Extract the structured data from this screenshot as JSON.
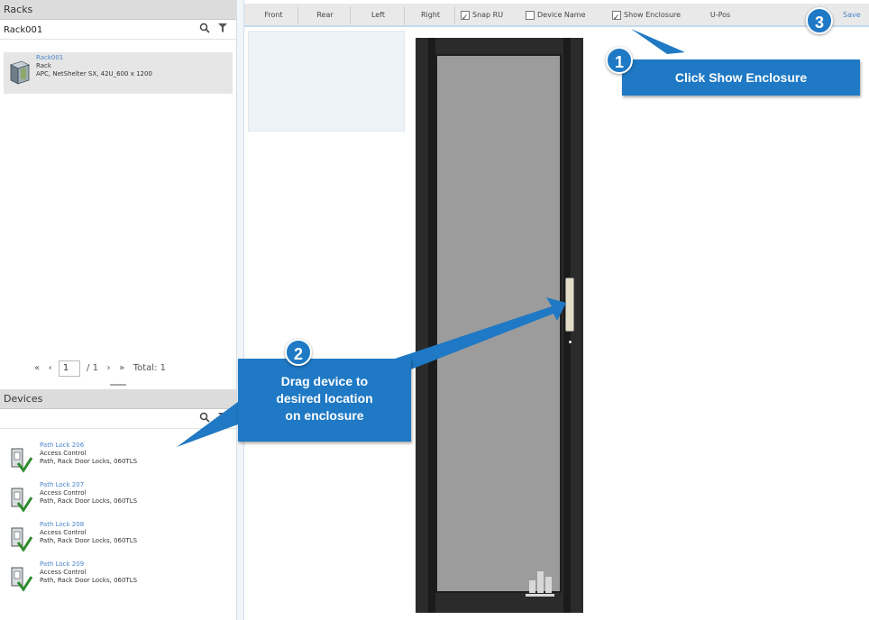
{
  "racks_panel": {
    "title": "Racks",
    "search_value": "Rack001",
    "rack_item": {
      "name": "Rack001",
      "type": "Rack",
      "model": "APC, NetShelter SX, 42U_600 x 1200"
    },
    "pager": {
      "first": "«",
      "prev": "‹",
      "page": "1",
      "of": "/ 1",
      "next": "›",
      "last": "»",
      "total": "Total: 1"
    }
  },
  "devices_panel": {
    "title": "Devices",
    "items": [
      {
        "name": "Path Lock 206",
        "category": "Access Control",
        "model": "Path, Rack Door Locks, 060TLS"
      },
      {
        "name": "Path Lock 207",
        "category": "Access Control",
        "model": "Path, Rack Door Locks, 060TLS"
      },
      {
        "name": "Path Lock 208",
        "category": "Access Control",
        "model": "Path, Rack Door Locks, 060TLS"
      },
      {
        "name": "Path Lock 209",
        "category": "Access Control",
        "model": "Path, Rack Door Locks, 060TLS"
      }
    ]
  },
  "toolbar": {
    "front": "Front",
    "rear": "Rear",
    "left": "Left",
    "right": "Right",
    "snap_ru": "Snap RU",
    "device_name": "Device Name",
    "show_enclosure": "Show Enclosure",
    "u_pos": "U-Pos",
    "save": "Save"
  },
  "callouts": {
    "step1_number": "1",
    "step1_text": "Click Show Enclosure",
    "step2_number": "2",
    "step2_text_line1": "Drag device to",
    "step2_text_line2": "desired location",
    "step2_text_line3": "on enclosure",
    "step3_number": "3"
  },
  "colors": {
    "callout_blue": "#1f79c4",
    "link_blue": "#4a86c7"
  }
}
